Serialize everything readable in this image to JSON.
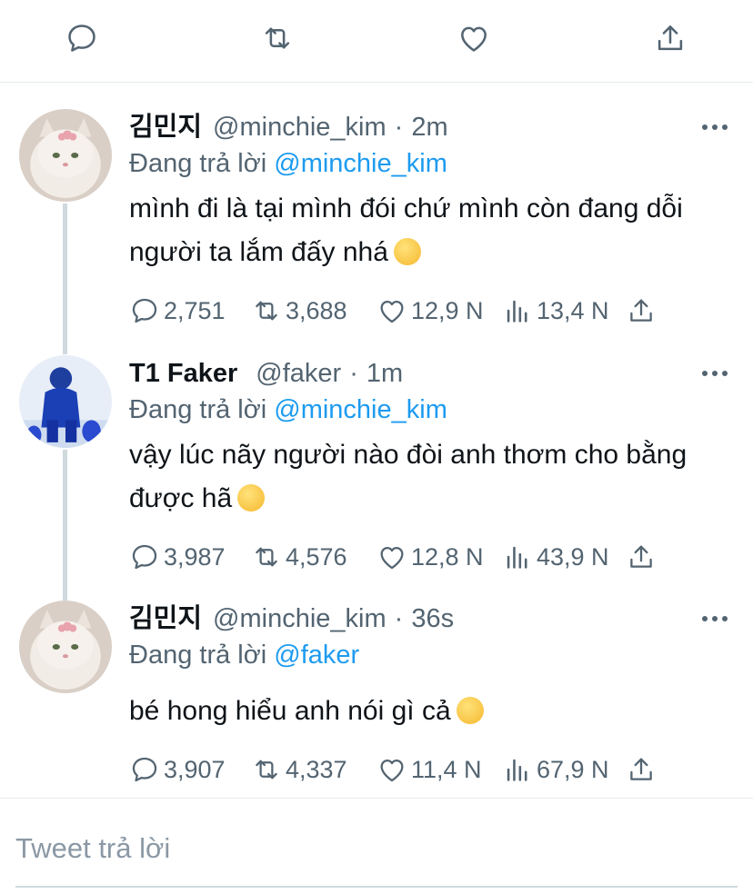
{
  "top_actions": {
    "reply_icon": "reply-icon",
    "retweet_icon": "retweet-icon",
    "like_icon": "like-icon",
    "share_icon": "share-icon"
  },
  "tweets": [
    {
      "name": "김민지",
      "handle": "@minchie_kim",
      "sep": "·",
      "time": "2m",
      "reply_prefix": "Đang trả lời",
      "reply_to": "@minchie_kim",
      "text": "mình đi là tại mình đói chứ mình còn đang dỗi người ta lắm đấy nhá",
      "emoji": "smirk",
      "replies": "2,751",
      "retweets": "3,688",
      "likes": "12,9 N",
      "views": "13,4 N"
    },
    {
      "name": "T1 Faker",
      "handle": "@faker",
      "sep": "·",
      "time": "1m",
      "reply_prefix": "Đang trả lời",
      "reply_to": "@minchie_kim",
      "text": "vậy lúc nãy người nào đòi anh thơm cho bằng được hã",
      "emoji": "sleeping",
      "replies": "3,987",
      "retweets": "4,576",
      "likes": "12,8 N",
      "views": "43,9 N"
    },
    {
      "name": "김민지",
      "handle": "@minchie_kim",
      "sep": "·",
      "time": "36s",
      "reply_prefix": "Đang trả lời",
      "reply_to": "@faker",
      "text": "bé hong hiểu anh nói gì cả",
      "emoji": "peeking",
      "replies": "3,907",
      "retweets": "4,337",
      "likes": "11,4 N",
      "views": "67,9 N"
    }
  ],
  "compose": {
    "placeholder": "Tweet trả lời"
  },
  "colors": {
    "accent": "#1d9bf0",
    "muted": "#536471",
    "text": "#0f1419",
    "divider": "#e6ecf0"
  }
}
